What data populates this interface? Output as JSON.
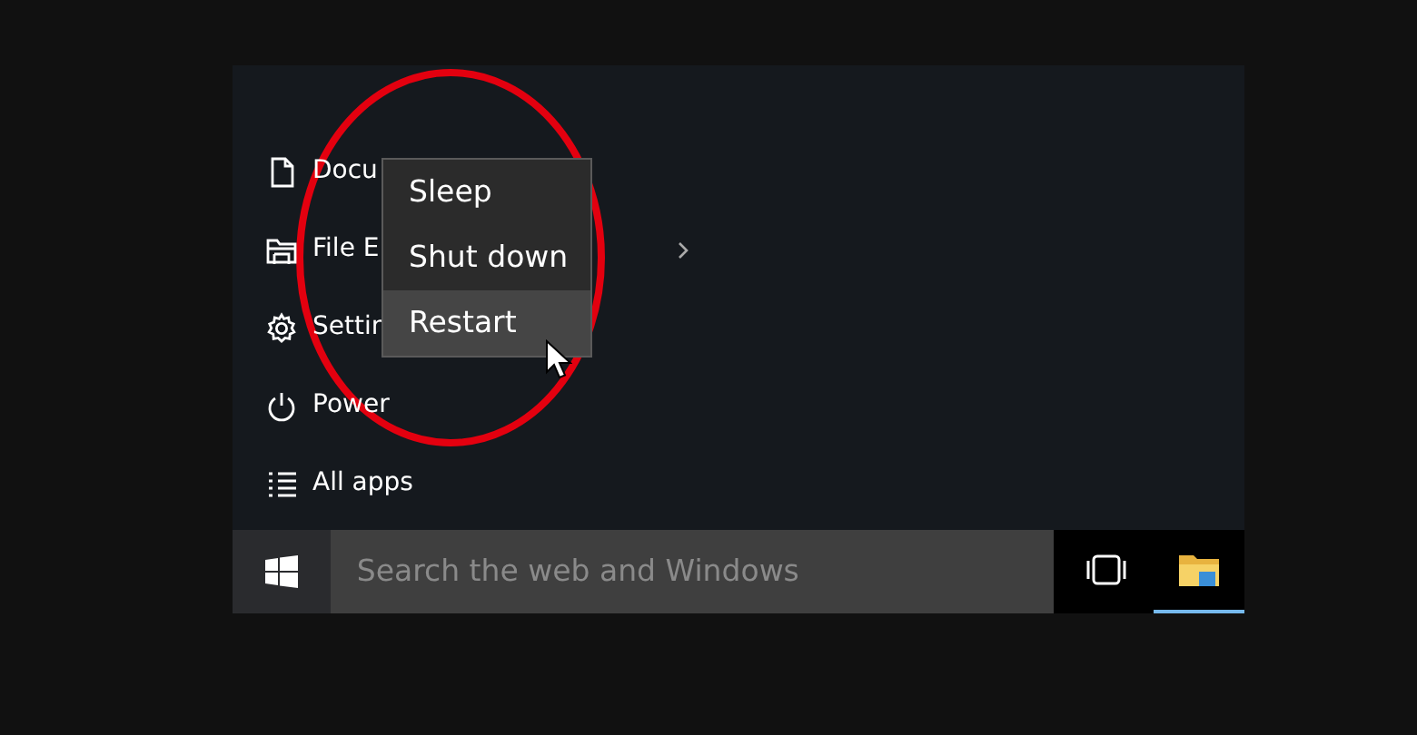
{
  "start_menu": {
    "items": [
      {
        "label": "Docu",
        "kind": "document",
        "submenu": false
      },
      {
        "label": "File E",
        "kind": "folder",
        "submenu": true
      },
      {
        "label": "Settin",
        "kind": "gear",
        "submenu": false
      },
      {
        "label": "Power",
        "kind": "power",
        "submenu": false
      },
      {
        "label": "All apps",
        "kind": "list",
        "submenu": false
      }
    ]
  },
  "power_menu": {
    "items": [
      {
        "label": "Sleep",
        "selected": false
      },
      {
        "label": "Shut down",
        "selected": false
      },
      {
        "label": "Restart",
        "selected": true
      }
    ]
  },
  "taskbar": {
    "search": {
      "placeholder": "Search the web and Windows"
    },
    "apps": [
      {
        "kind": "task-view",
        "active": false
      },
      {
        "kind": "folder",
        "active": true
      }
    ]
  }
}
